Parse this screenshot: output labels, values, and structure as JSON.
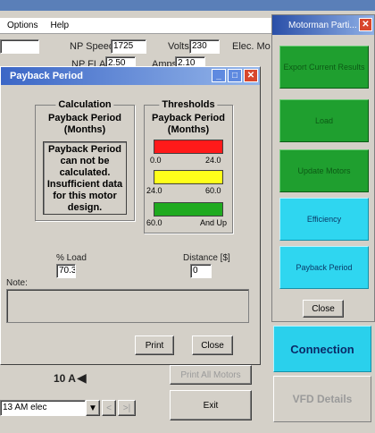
{
  "menu": {
    "items": [
      "Options",
      "Help"
    ]
  },
  "main": {
    "np_speed_label": "NP Speed",
    "np_speed_value": "1725",
    "volts_label": "Volts",
    "volts_value": "230",
    "elec_label": "Elec. Mo",
    "np_fla_label": "NP FLA",
    "np_fla_value": "2.50",
    "amps_label": "Amps",
    "amps_value": "2.10",
    "amps_indicator": "10 A",
    "dropdown_value": "13 AM elec",
    "print_all_label": "Print All Motors",
    "exit_label": "Exit"
  },
  "right_panel": {
    "title": "Motorman Parti...",
    "buttons": [
      "Export Current Results",
      "Load",
      "Update Motors",
      "Efficiency",
      "Payback Period"
    ],
    "close_label": "Close",
    "connection_label": "Connection",
    "vfd_label": "VFD Details"
  },
  "dialog": {
    "title": "Payback Period",
    "calc": {
      "group_title": "Calculation",
      "subtitle": "Payback Period (Months)",
      "message": "Payback Period can not be calculated. Insufficient data for this motor design."
    },
    "thresholds": {
      "group_title": "Thresholds",
      "subtitle": "Payback Period (Months)",
      "bars": [
        {
          "color": "#ff1a1a",
          "min": "0.0",
          "max": "24.0"
        },
        {
          "color": "#ffff1a",
          "min": "24.0",
          "max": "60.0"
        },
        {
          "color": "#1faa1f",
          "min": "60.0",
          "max": "And Up"
        }
      ]
    },
    "load_label": "% Load",
    "load_value": "70.3",
    "distance_label": "Distance [$]",
    "distance_value": "0",
    "note_label": "Note:",
    "print_label": "Print",
    "close_label": "Close"
  }
}
